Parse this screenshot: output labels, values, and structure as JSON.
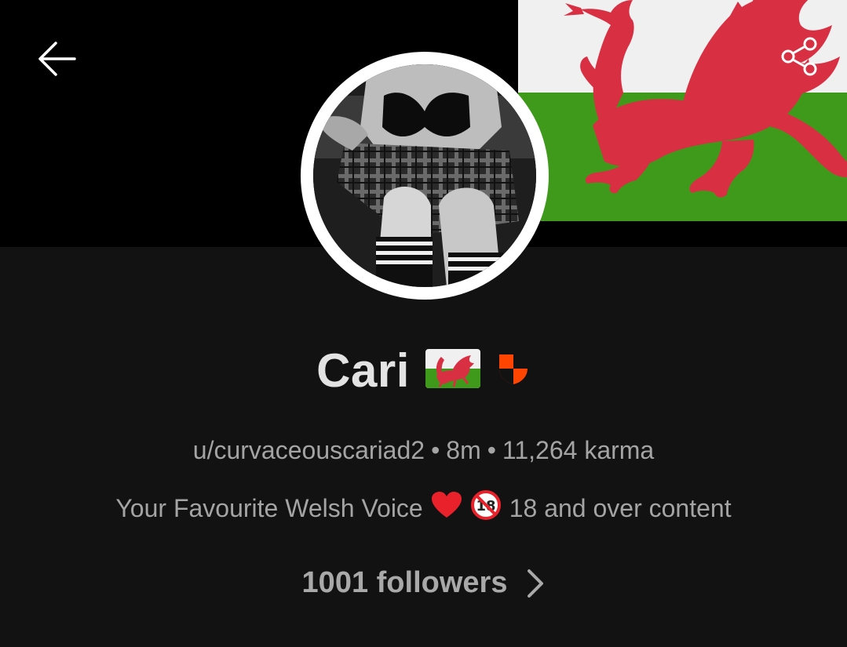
{
  "profile": {
    "display_name": "Cari",
    "username": "u/curvaceouscariad2",
    "account_age": "8m",
    "karma": "11,264 karma",
    "bio_text": "Your Favourite Welsh Voice",
    "bio_suffix": "18 and over content",
    "followers": "1001 followers",
    "badges": [
      "welsh-flag-icon",
      "mod-shield-icon"
    ]
  },
  "header": {
    "back_icon": "arrow-left-icon",
    "share_icon": "share-icon"
  },
  "colors": {
    "background": "#121212",
    "banner": "#000000",
    "flag_white": "#f0f0f0",
    "flag_green": "#3f9a1b",
    "dragon_red": "#d82f43",
    "mod_shield_orange": "#ff4500",
    "text_primary": "#e3e3e3",
    "text_secondary": "#a4a4a4"
  }
}
